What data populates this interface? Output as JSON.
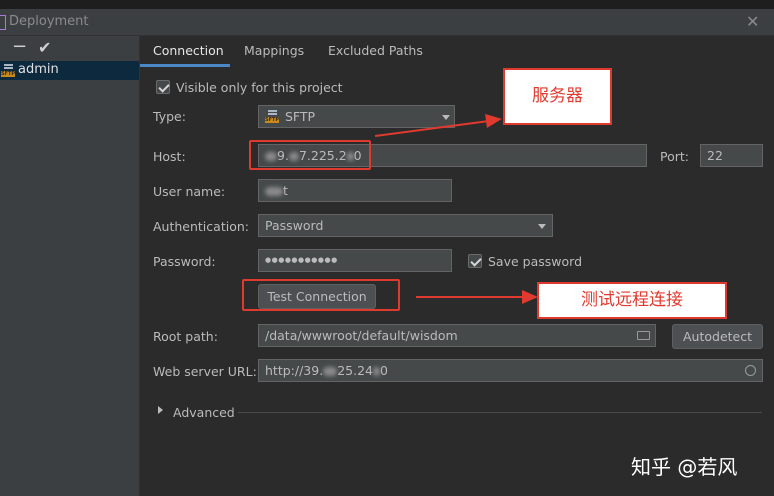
{
  "window": {
    "title": "Deployment"
  },
  "sidebar": {
    "server_name": "admin",
    "server_icon_badge": "SFTP"
  },
  "tabs": [
    "Connection",
    "Mappings",
    "Excluded Paths"
  ],
  "form": {
    "visible_only_label": "Visible only for this project",
    "type_label": "Type:",
    "type_value": "SFTP",
    "type_badge": "SFTP",
    "host_label": "Host:",
    "host_value_a": "9.",
    "host_value_b": "7.225.2",
    "host_value_c": "0",
    "port_label": "Port:",
    "port_value": "22",
    "username_label": "User name:",
    "username_value": "t",
    "auth_label": "Authentication:",
    "auth_value": "Password",
    "password_label": "Password:",
    "password_value": "●●●●●●●●●●●",
    "save_password_label": "Save password",
    "test_connection_label": "Test Connection",
    "root_path_label": "Root path:",
    "root_path_value": "/data/wwwroot/default/wisdom",
    "autodetect_label": "Autodetect",
    "web_url_label": "Web server URL:",
    "web_url_value_a": "http://39.",
    "web_url_value_b": "25.24",
    "web_url_value_c": "0",
    "advanced_label": "Advanced"
  },
  "annotations": {
    "server_label": "服务器",
    "test_label": "测试远程连接",
    "color": "#e03a2e"
  },
  "watermark": "知乎 @若风"
}
